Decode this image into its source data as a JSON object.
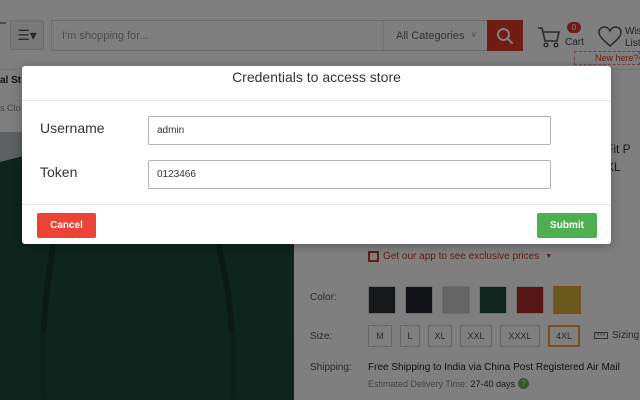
{
  "header": {
    "search_placeholder": "I'm shopping for...",
    "category_select": "All Categories",
    "cart_count": "0",
    "cart_label": "Cart",
    "wishlist_label_line1": "Wis",
    "wishlist_label_line2": "List",
    "new_here": "New here?"
  },
  "nav": {
    "fragment": "al St"
  },
  "breadcrumb": {
    "fragment": "s Clo"
  },
  "product": {
    "title_line1": "Fit P",
    "title_line2": "XL",
    "app_promo": "Get our app to see exclusive prices",
    "color_label": "Color:",
    "size_label": "Size:",
    "sizes": [
      "M",
      "L",
      "XL",
      "XXL",
      "XXXL",
      "4XL"
    ],
    "selected_size": "4XL",
    "sizing_label": "Sizing",
    "shipping_label": "Shipping:",
    "shipping_text": "Free Shipping to India via China Post Registered Air Mail",
    "delivery_label": "Estimated Delivery Time:",
    "delivery_value": "27-40 days",
    "help_glyph": "?",
    "swatch_colors": [
      "#2c2f33",
      "#23262e",
      "#c9c9c9",
      "#1f4a3a",
      "#b02a2a",
      "#d4b23a"
    ]
  },
  "modal": {
    "title": "Credentials to access store",
    "username_label": "Username",
    "username_value": "admin",
    "token_label": "Token",
    "token_value": "0123466",
    "cancel_label": "Cancel",
    "submit_label": "Submit"
  },
  "colors": {
    "accent_red": "#e33a2a",
    "cancel_red": "#ed4337",
    "submit_green": "#4caf50",
    "overlay": "rgba(0,0,0,0.5)"
  }
}
